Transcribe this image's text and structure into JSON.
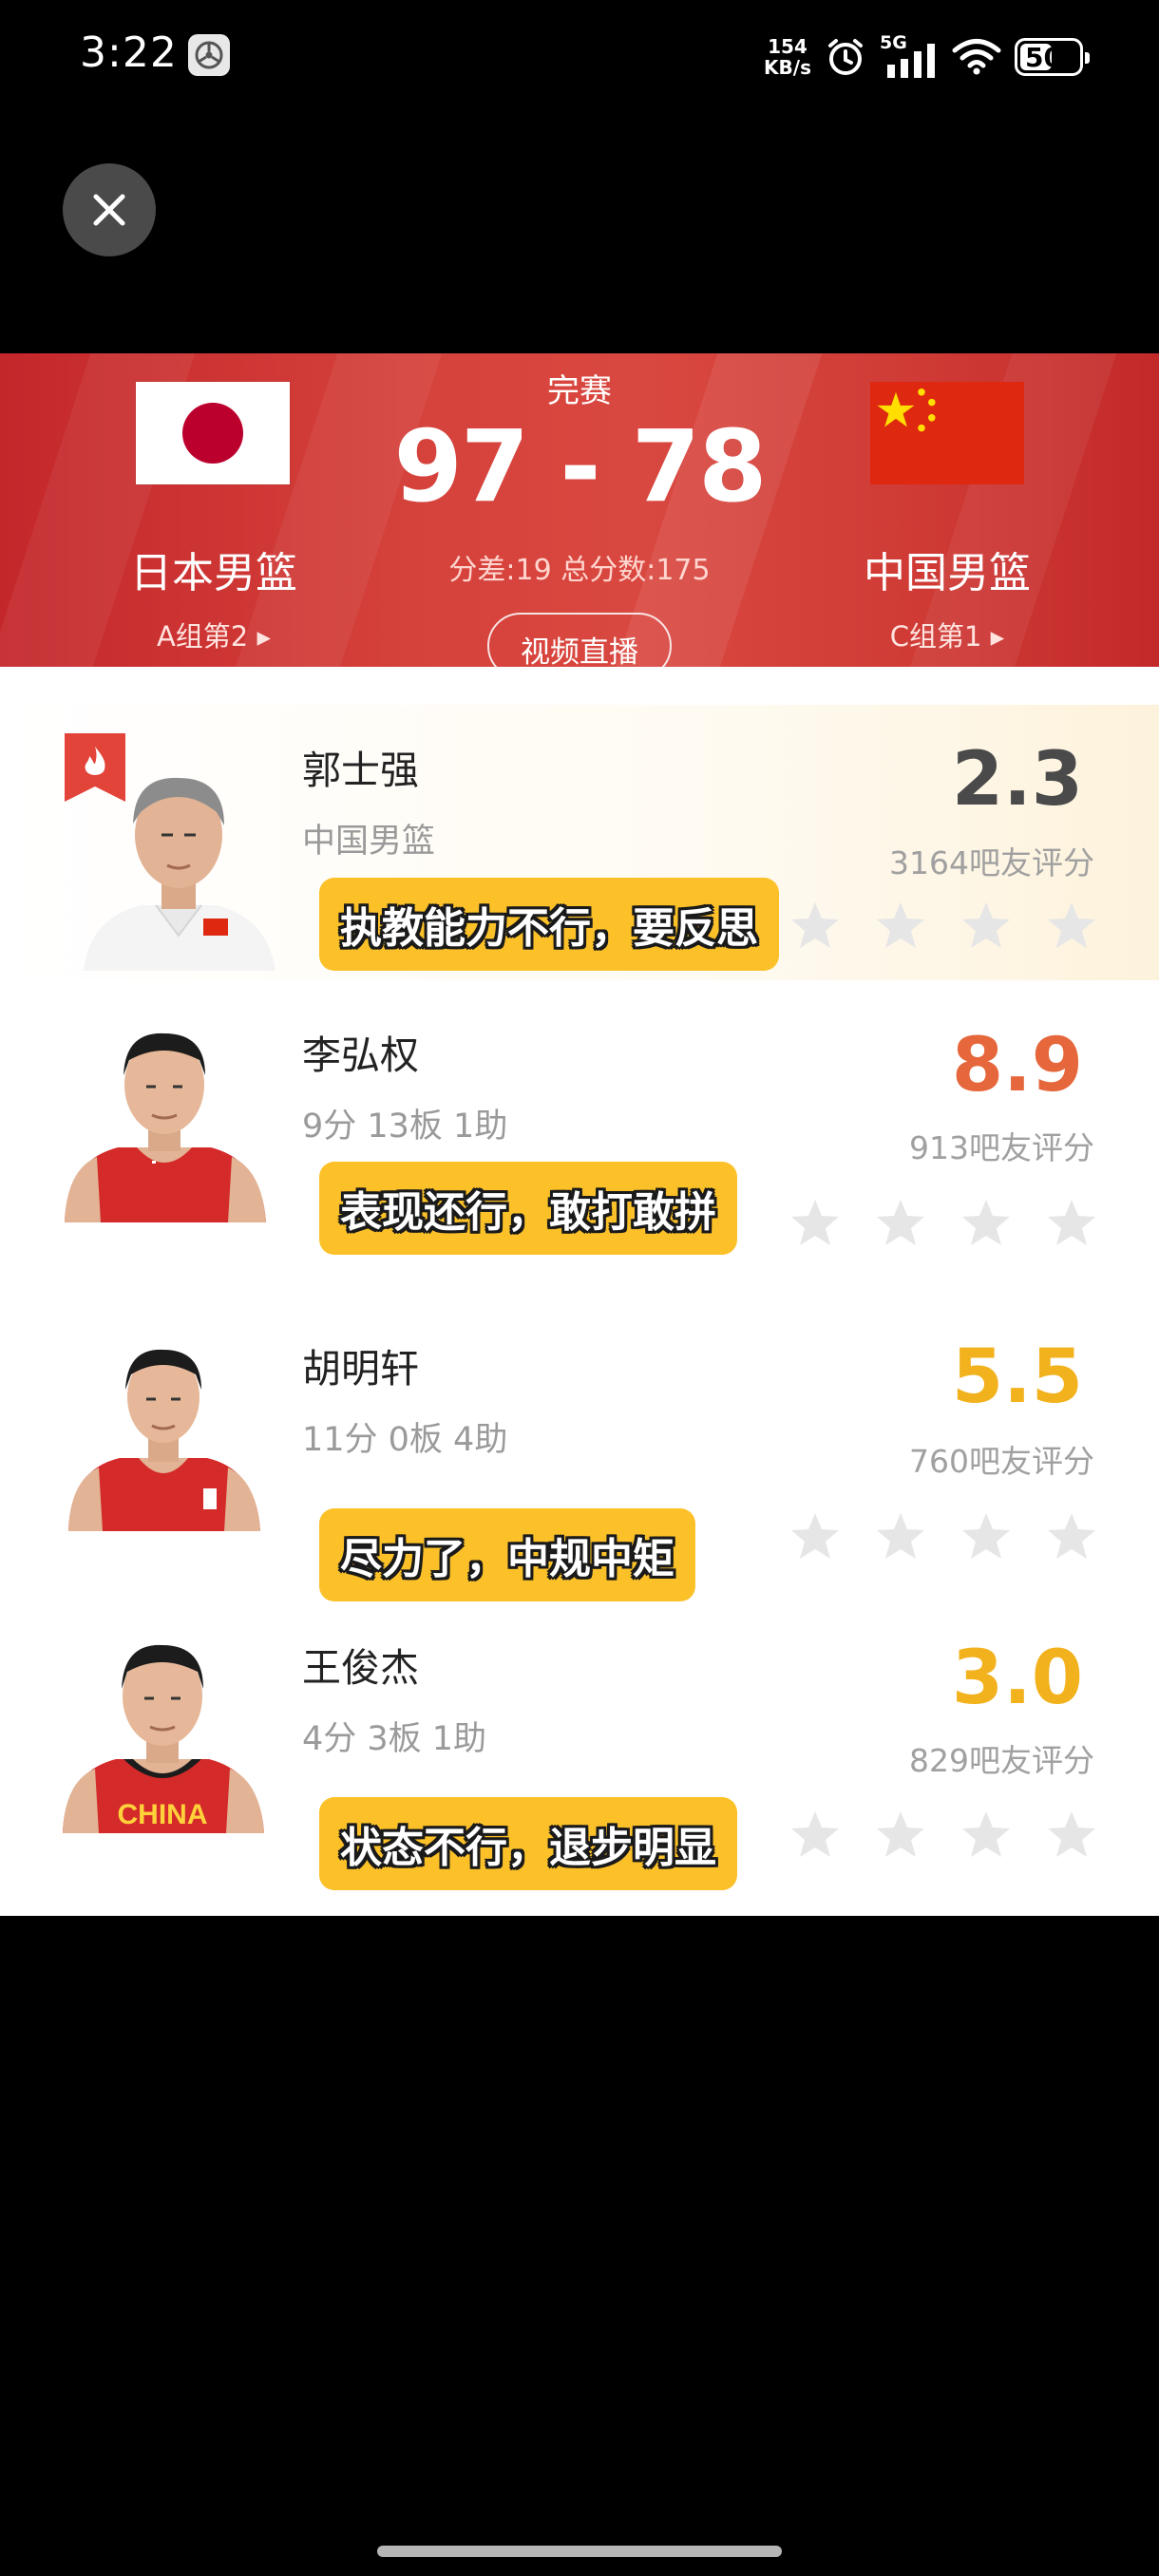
{
  "status_bar": {
    "time": "3:22",
    "net_speed_value": "154",
    "net_speed_unit": "KB/s",
    "network_type": "5G",
    "battery_level": "50"
  },
  "match": {
    "status": "完赛",
    "score": "97 - 78",
    "summary": "分差:19 总分数:175",
    "video_button": "视频直播",
    "home_team": {
      "name": "日本男篮",
      "rank": "A组第2 ▸"
    },
    "away_team": {
      "name": "中国男篮",
      "rank": "C组第1 ▸"
    }
  },
  "ratings": [
    {
      "name": "郭士强",
      "subtitle": "中国男篮",
      "score": "2.3",
      "score_color": "#4a4a4a",
      "count": "3164吧友评分",
      "comment": "执教能力不行，要反思"
    },
    {
      "name": "李弘权",
      "subtitle": "9分 13板 1助",
      "score": "8.9",
      "score_color": "#e5673b",
      "count": "913吧友评分",
      "comment": "表现还行，敢打敢拼"
    },
    {
      "name": "胡明轩",
      "subtitle": "11分 0板 4助",
      "score": "5.5",
      "score_color": "#f2b21e",
      "count": "760吧友评分",
      "comment": "尽力了，中规中矩"
    },
    {
      "name": "王俊杰",
      "subtitle": "4分 3板 1助",
      "score": "3.0",
      "score_color": "#f2b21e",
      "count": "829吧友评分",
      "comment": "状态不行，退步明显"
    }
  ],
  "jersey_text": "CHINA",
  "colors": {
    "banner_red": "#d5413b",
    "comment_yellow": "#fcc129",
    "star_gray": "#e6e6e6"
  }
}
